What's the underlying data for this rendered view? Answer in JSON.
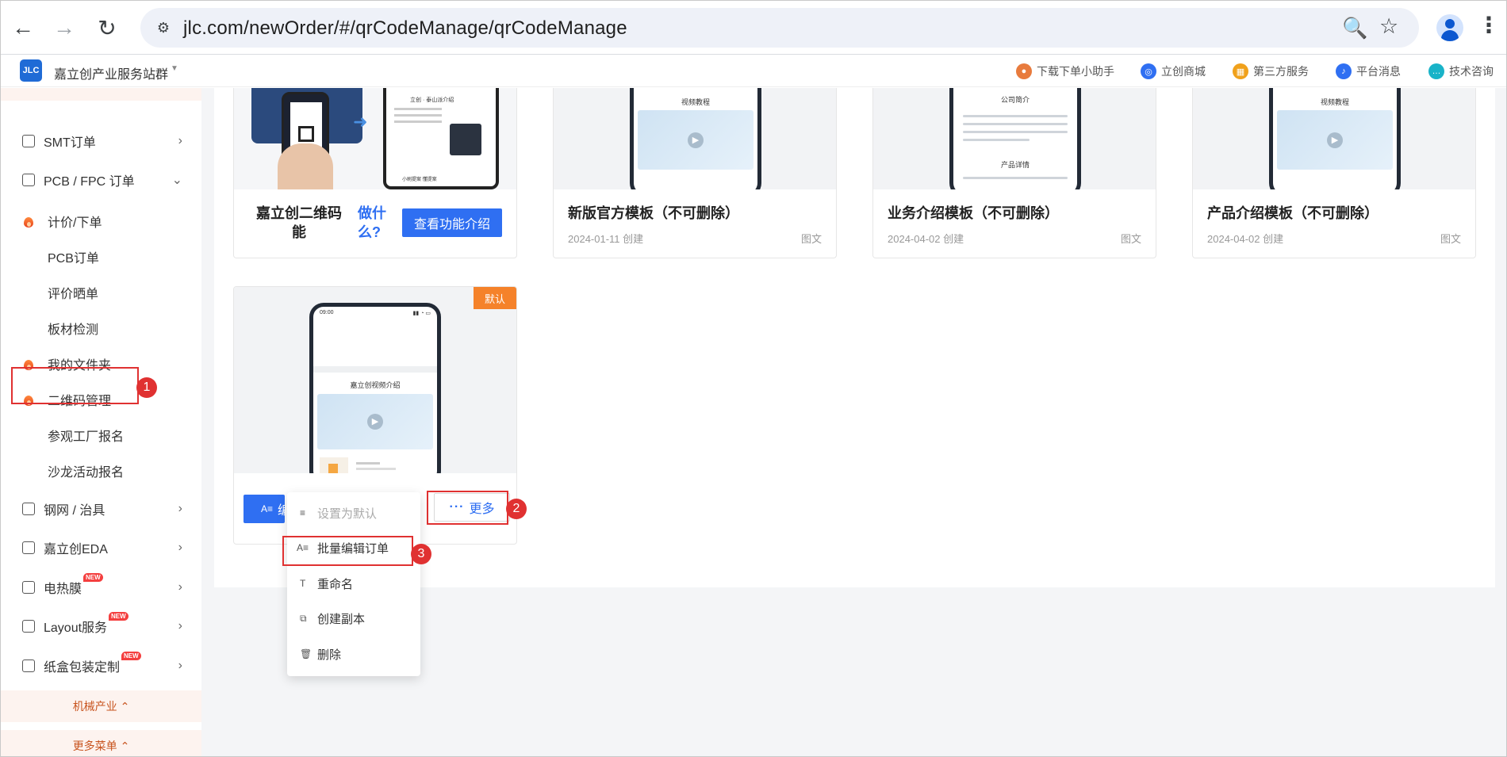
{
  "browser": {
    "url": "jlc.com/newOrder/#/qrCodeManage/qrCodeManage",
    "back_icon": "←",
    "forward_icon": "→",
    "reload_icon": "↻",
    "site_icon": "⚙",
    "zoom_icon": "🔍",
    "star_icon": "☆",
    "menu_icon": "⋮"
  },
  "header": {
    "logo_text": "JLC",
    "brand": "嘉立创产业服务站群",
    "links": [
      {
        "label": "下载下单小助手",
        "icon_color": "#e87b3d"
      },
      {
        "label": "立创商城",
        "icon_color": "#2f6ff2"
      },
      {
        "label": "第三方服务",
        "icon_color": "#f0a11b"
      },
      {
        "label": "平台消息",
        "icon_color": "#2f6ff2"
      },
      {
        "label": "技术咨询",
        "icon_color": "#19b3c8"
      }
    ]
  },
  "sidebar": {
    "items": [
      {
        "label": "SMT订单",
        "arrow": "›"
      },
      {
        "label": "PCB / FPC 订单",
        "arrow": "⌄"
      },
      {
        "label": "计价/下单"
      },
      {
        "label": "PCB订单"
      },
      {
        "label": "评价晒单"
      },
      {
        "label": "板材检测"
      },
      {
        "label": "我的文件夹"
      },
      {
        "label": "二维码管理"
      },
      {
        "label": "参观工厂报名"
      },
      {
        "label": "沙龙活动报名"
      },
      {
        "label": "钢网 / 治具",
        "arrow": "›"
      },
      {
        "label": "嘉立创EDA",
        "arrow": "›"
      },
      {
        "label": "电热膜",
        "arrow": "›",
        "badge": "NEW"
      },
      {
        "label": "Layout服务",
        "arrow": "›",
        "badge": "NEW"
      },
      {
        "label": "纸盒包装定制",
        "arrow": "›",
        "badge": "NEW"
      }
    ],
    "bands": [
      {
        "label": "机械产业 ⌃"
      },
      {
        "label": "更多菜单 ⌃"
      }
    ]
  },
  "steps": [
    "1",
    "2",
    "3"
  ],
  "promo": {
    "title": "嘉立创二维码能",
    "question": "做什么?",
    "button": "查看功能介绍"
  },
  "templates": [
    {
      "title": "新版官方模板（不可删除）",
      "date": "2024-01-11 创建",
      "type": "图文",
      "phone_title": "视频教程"
    },
    {
      "title": "业务介绍模板（不可删除）",
      "date": "2024-04-02 创建",
      "type": "图文",
      "phone_title": "公司简介",
      "phone_subtitle": "产品详情"
    },
    {
      "title": "产品介绍模板（不可删除）",
      "date": "2024-04-02 创建",
      "type": "图文",
      "phone_title": "视频教程"
    }
  ],
  "default_card": {
    "tag": "默认",
    "phone_time": "09:00",
    "phone_section": "嘉立创视频介绍",
    "edit_button": "编",
    "more_button": "更多",
    "more_icon": "···"
  },
  "dropdown": {
    "items": [
      {
        "label": "设置为默认",
        "icon": "≡",
        "disabled": true
      },
      {
        "label": "批量编辑订单",
        "icon": "A≡"
      },
      {
        "label": "重命名",
        "icon": "T"
      },
      {
        "label": "创建副本",
        "icon": "⧉"
      },
      {
        "label": "删除",
        "icon": "🗑"
      }
    ]
  }
}
